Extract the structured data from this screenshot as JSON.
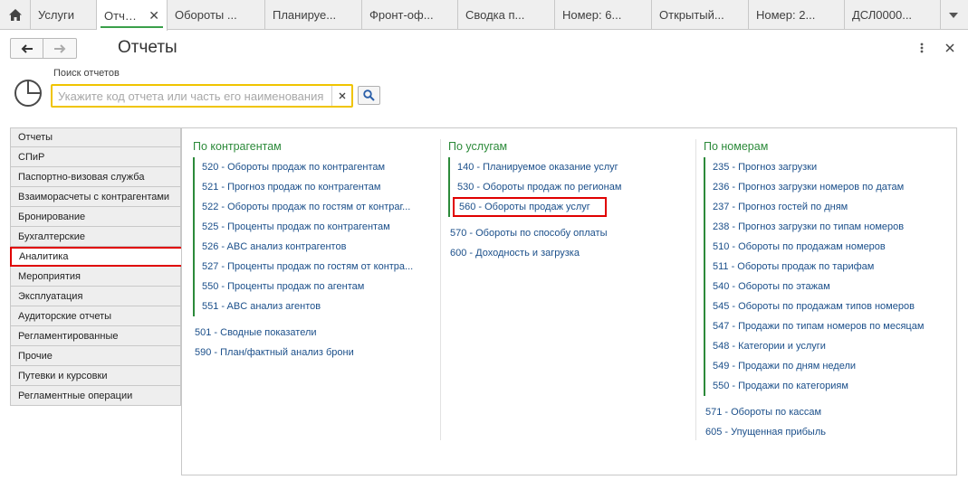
{
  "tabs": [
    {
      "label": "Услуги",
      "active": false
    },
    {
      "label": "Отчеты",
      "active": true
    },
    {
      "label": "Обороты ...",
      "active": false
    },
    {
      "label": "Планируе...",
      "active": false
    },
    {
      "label": "Фронт-оф...",
      "active": false
    },
    {
      "label": "Сводка п...",
      "active": false
    },
    {
      "label": "Номер: 6...",
      "active": false
    },
    {
      "label": "Открытый...",
      "active": false
    },
    {
      "label": "Номер: 2...",
      "active": false
    },
    {
      "label": "ДСЛ0000...",
      "active": false
    }
  ],
  "header": {
    "title": "Отчеты"
  },
  "search": {
    "label": "Поиск отчетов",
    "placeholder": "Укажите код отчета или часть его наименования",
    "value": ""
  },
  "sidebar": {
    "items": [
      {
        "label": "Отчеты"
      },
      {
        "label": "СПиР"
      },
      {
        "label": "Паспортно-визовая служба"
      },
      {
        "label": "Взаиморасчеты с контрагентами"
      },
      {
        "label": "Бронирование"
      },
      {
        "label": "Бухгалтерские"
      },
      {
        "label": "Аналитика",
        "selected": true
      },
      {
        "label": "Мероприятия"
      },
      {
        "label": "Эксплуатация"
      },
      {
        "label": "Аудиторские отчеты"
      },
      {
        "label": "Регламентированные"
      },
      {
        "label": "Прочие"
      },
      {
        "label": "Путевки и курсовки"
      },
      {
        "label": "Регламентные операции"
      }
    ]
  },
  "columns": [
    {
      "title": "По контрагентам",
      "grouped": [
        "520 - Обороты продаж по контрагентам",
        "521 - Прогноз продаж по контрагентам",
        "522 - Обороты продаж по гостям от контраг...",
        "525 - Проценты продаж по контрагентам",
        "526 - ABC анализ контрагентов",
        "527 - Проценты продаж по гостям от контра...",
        "550 - Проценты продаж по агентам",
        "551 - ABC анализ агентов"
      ],
      "extra": [
        "501 - Сводные показатели",
        "590 - План/фактный анализ брони"
      ]
    },
    {
      "title": "По услугам",
      "grouped": [
        "140 - Планируемое оказание услуг",
        "530 - Обороты продаж по регионам",
        "560 - Обороты продаж услуг"
      ],
      "extra": [
        "570 - Обороты по способу оплаты",
        "600 - Доходность и загрузка"
      ]
    },
    {
      "title": "По номерам",
      "grouped": [
        "235 - Прогноз загрузки",
        "236 - Прогноз загрузки номеров по датам",
        "237 - Прогноз гостей по дням",
        "238 - Прогноз загрузки по типам номеров",
        "510 - Обороты по продажам номеров",
        "511 - Обороты продаж по тарифам",
        "540 - Обороты по этажам",
        "545 - Обороты по продажам типов номеров",
        "547 - Продажи по типам номеров по месяцам",
        "548 - Категории и услуги",
        "549 - Продажи по дням недели",
        "550 - Продажи по категориям"
      ],
      "extra": [
        "571 - Обороты по кассам",
        "605 - Упущенная прибыль"
      ]
    }
  ],
  "colors": {
    "accent_green": "#2c8a3a",
    "link_blue": "#1b4f8a",
    "highlight_red": "#e00000",
    "search_border": "#f0c400"
  },
  "icons": {
    "home": "home-icon",
    "back": "arrow-left-icon",
    "forward": "arrow-right-icon",
    "menu": "more-vertical-icon",
    "close": "close-icon",
    "search": "search-icon",
    "reports": "pie-chart-icon"
  }
}
